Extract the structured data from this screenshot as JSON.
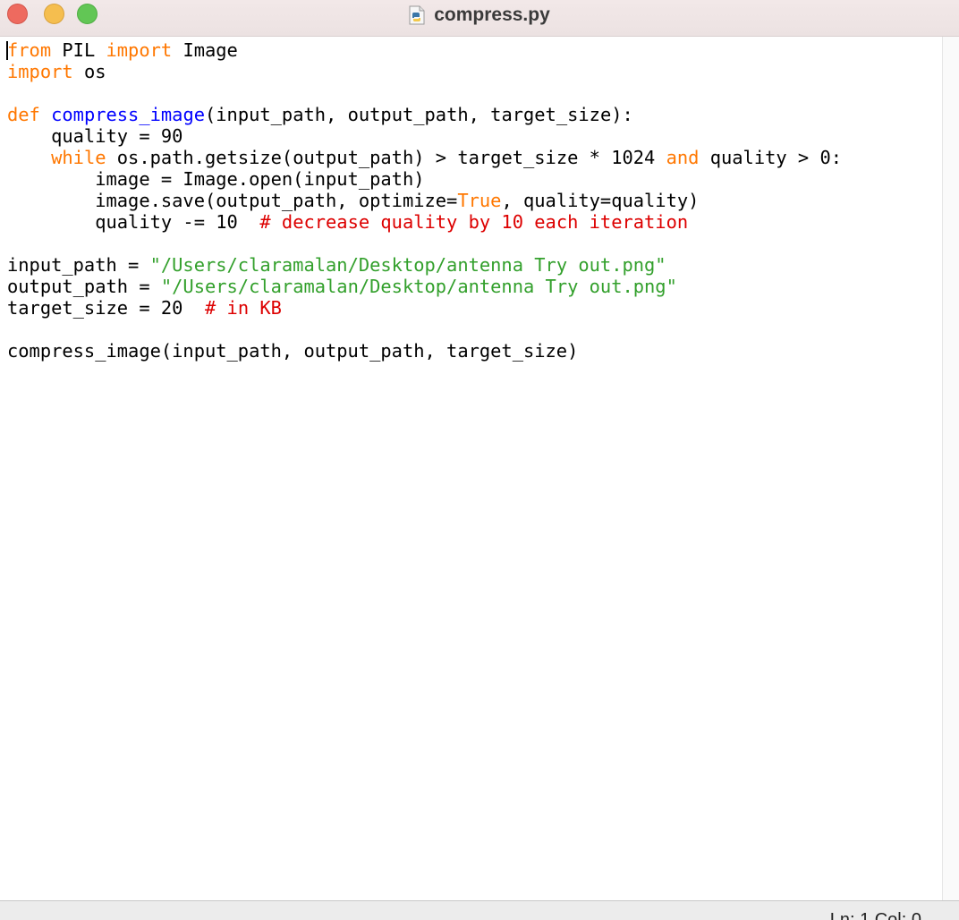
{
  "window": {
    "title": "compress.py",
    "file_icon": "python-file-icon",
    "traffic_lights": [
      "close",
      "minimize",
      "maximize"
    ]
  },
  "colors": {
    "keyword": "#ff7700",
    "builtin_def": "#0000ff",
    "string": "#33a02c",
    "comment": "#dd0000",
    "text": "#000000"
  },
  "code": {
    "lines": [
      [
        {
          "t": "from",
          "c": "kw"
        },
        {
          "t": " PIL "
        },
        {
          "t": "import",
          "c": "kw"
        },
        {
          "t": " Image"
        }
      ],
      [
        {
          "t": "import",
          "c": "kw"
        },
        {
          "t": " os"
        }
      ],
      [],
      [
        {
          "t": "def",
          "c": "kw"
        },
        {
          "t": " "
        },
        {
          "t": "compress_image",
          "c": "fn"
        },
        {
          "t": "(input_path, output_path, target_size):"
        }
      ],
      [
        {
          "t": "    quality = 90"
        }
      ],
      [
        {
          "t": "    "
        },
        {
          "t": "while",
          "c": "kw"
        },
        {
          "t": " os.path.getsize(output_path) > target_size * 1024 "
        },
        {
          "t": "and",
          "c": "kw"
        },
        {
          "t": " quality > 0:"
        }
      ],
      [
        {
          "t": "        image = Image.open(input_path)"
        }
      ],
      [
        {
          "t": "        image.save(output_path, optimize="
        },
        {
          "t": "True",
          "c": "kw"
        },
        {
          "t": ", quality=quality)"
        }
      ],
      [
        {
          "t": "        quality -= 10  "
        },
        {
          "t": "# decrease quality by 10 each iteration",
          "c": "cm"
        }
      ],
      [],
      [
        {
          "t": "input_path = "
        },
        {
          "t": "\"/Users/claramalan/Desktop/antenna Try out.png\"",
          "c": "str"
        }
      ],
      [
        {
          "t": "output_path = "
        },
        {
          "t": "\"/Users/claramalan/Desktop/antenna Try out.png\"",
          "c": "str"
        }
      ],
      [
        {
          "t": "target_size = 20  "
        },
        {
          "t": "# in KB",
          "c": "cm"
        }
      ],
      [],
      [
        {
          "t": "compress_image(input_path, output_path, target_size)"
        }
      ]
    ]
  },
  "status": {
    "position": "Ln: 1  Col: 0"
  }
}
